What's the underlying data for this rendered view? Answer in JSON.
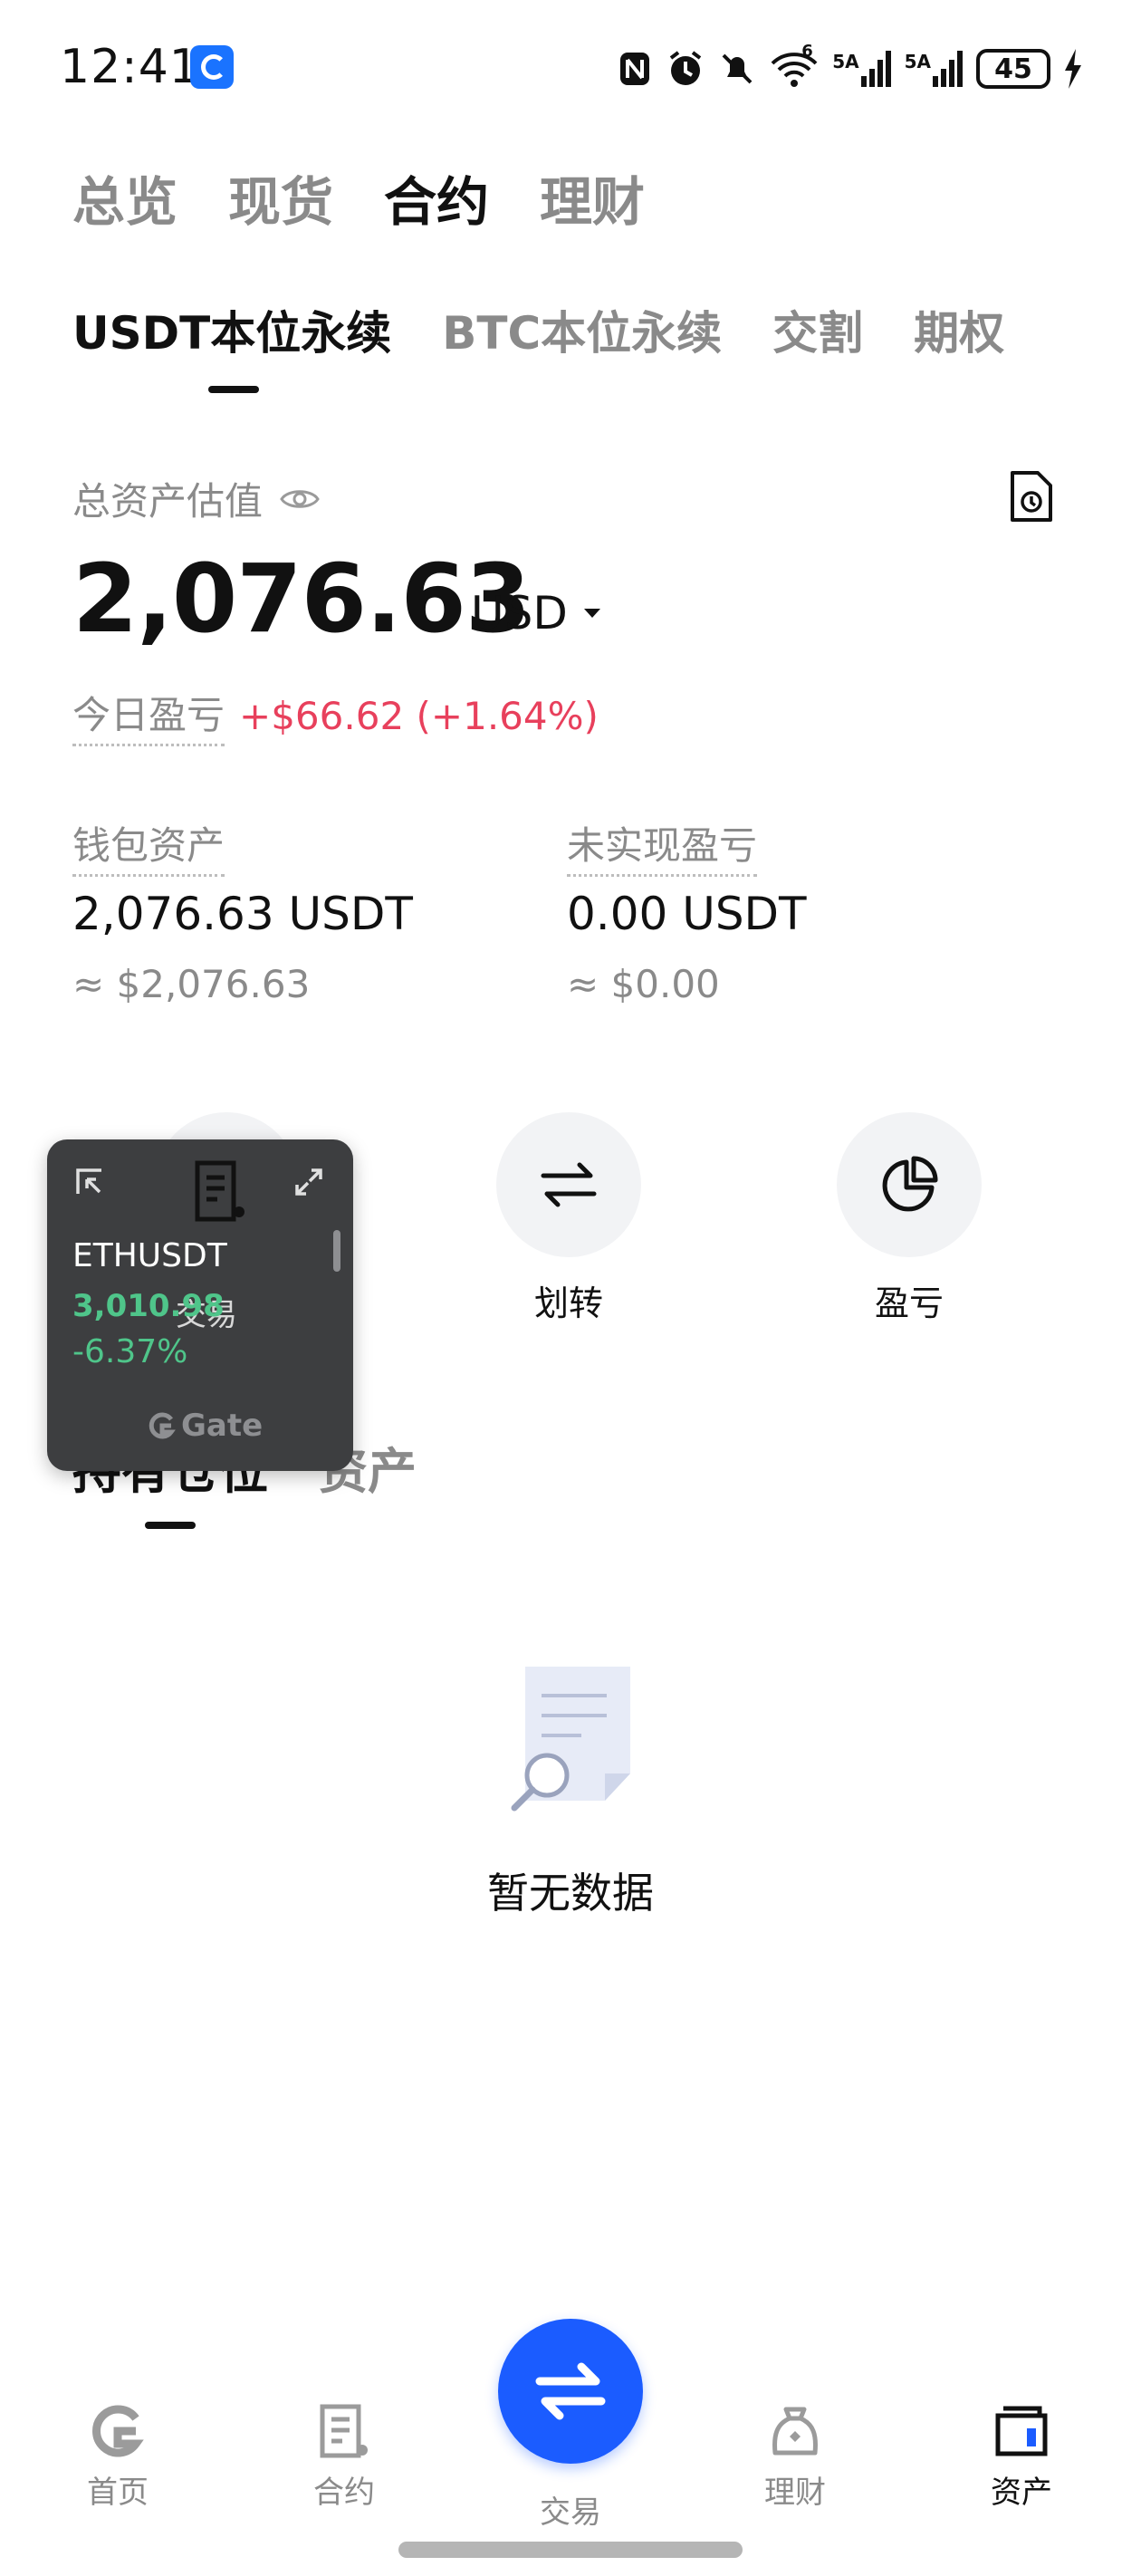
{
  "status_bar": {
    "time": "12:41",
    "network_1": "5A",
    "network_2": "5A",
    "wifi_badge": "6",
    "battery": "45"
  },
  "top_tabs": [
    {
      "label": "总览",
      "active": false
    },
    {
      "label": "现货",
      "active": false
    },
    {
      "label": "合约",
      "active": true
    },
    {
      "label": "理财",
      "active": false
    }
  ],
  "sub_tabs": [
    {
      "label": "USDT本位永续",
      "active": true
    },
    {
      "label": "BTC本位永续",
      "active": false
    },
    {
      "label": "交割",
      "active": false
    },
    {
      "label": "期权",
      "active": false
    }
  ],
  "summary": {
    "total_label": "总资产估值",
    "total_value": "2,076.63",
    "currency": "USD",
    "today_label": "今日盈亏",
    "today_value": "+$66.62 (+1.64%)",
    "wallet_label": "钱包资产",
    "wallet_value": "2,076.63 USDT",
    "wallet_approx": "≈ $2,076.63",
    "unrealized_label": "未实现盈亏",
    "unrealized_value": "0.00 USDT",
    "unrealized_approx": "≈ $0.00"
  },
  "actions": {
    "trade": "交易",
    "transfer": "划转",
    "pnl": "盈亏"
  },
  "position_tabs": [
    {
      "label": "持有仓位",
      "active": true
    },
    {
      "label": "资产",
      "active": false
    }
  ],
  "empty_state": {
    "text": "暂无数据"
  },
  "widget": {
    "symbol": "ETHUSDT",
    "price": "3,010.98",
    "change": "-6.37%",
    "brand": "Gate"
  },
  "bottom_nav": {
    "home": "首页",
    "contract": "合约",
    "trade": "交易",
    "finance": "理财",
    "assets": "资产"
  },
  "colors": {
    "accent_blue": "#1b5cff",
    "profit_red": "#e8405c",
    "widget_green": "#4fc58a",
    "muted_gray": "#8a8a8a"
  }
}
